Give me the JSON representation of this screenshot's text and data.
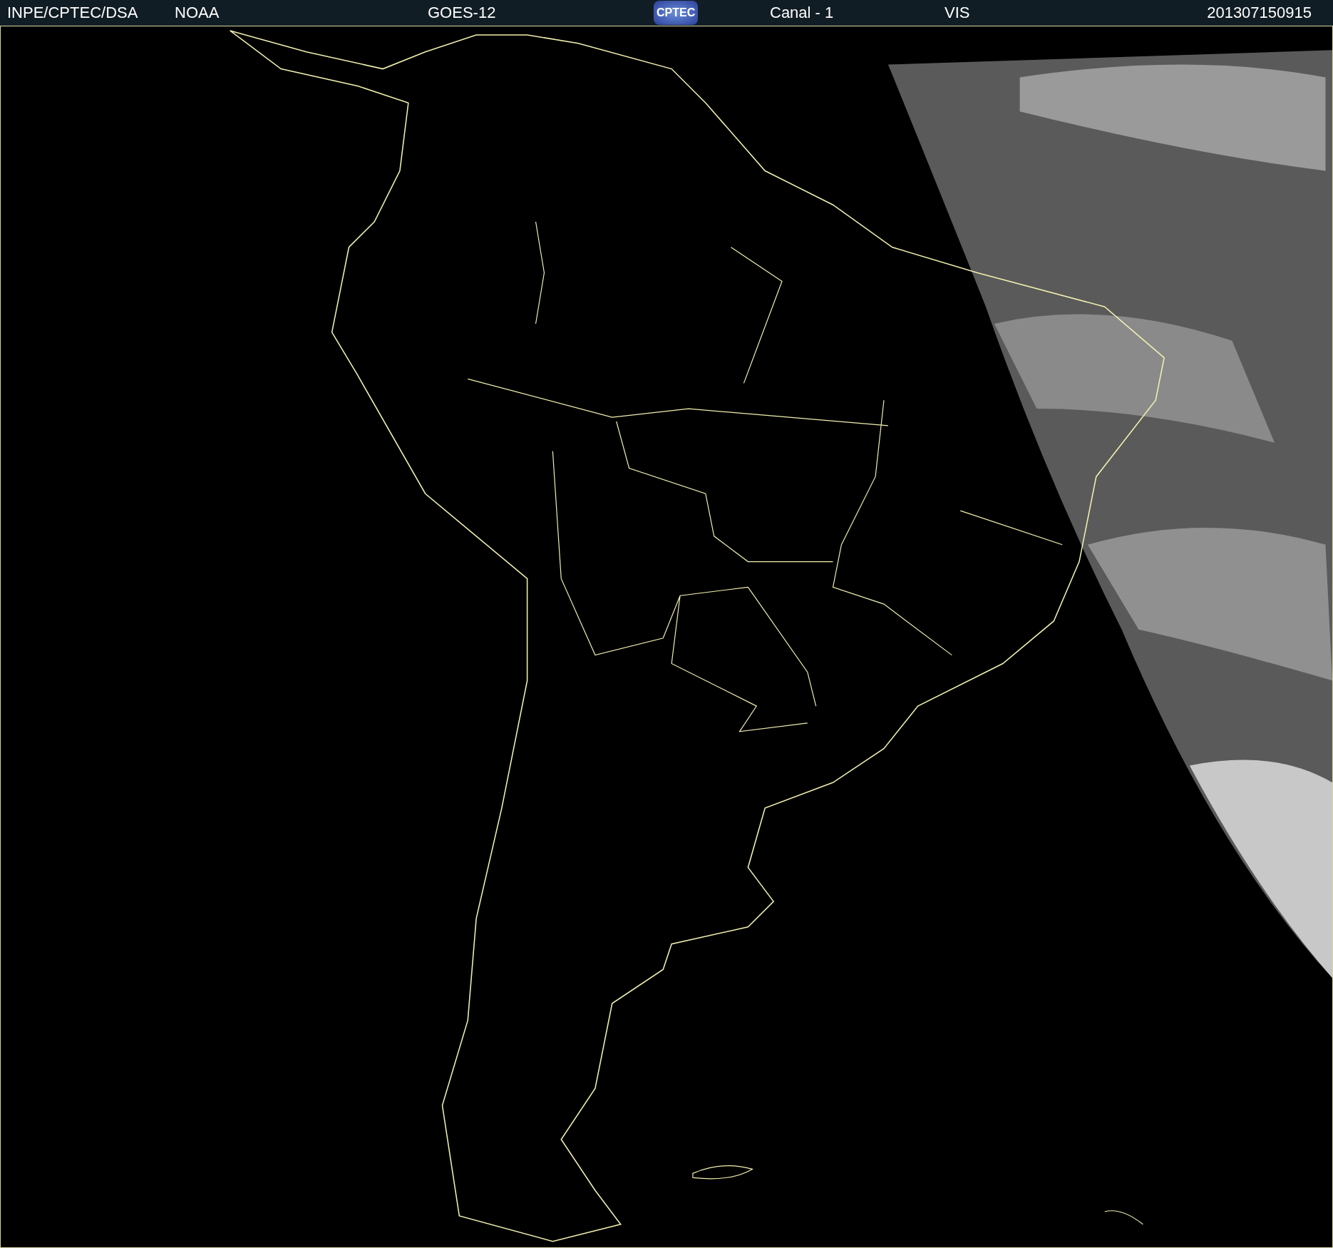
{
  "header": {
    "items": [
      {
        "kind": "text",
        "text": "INPE/CPTEC/DSA"
      },
      {
        "kind": "text",
        "text": "NOAA"
      },
      {
        "kind": "text",
        "text": "GOES-12"
      },
      {
        "kind": "logo",
        "text": "CPTEC"
      },
      {
        "kind": "text",
        "text": "Canal - 1"
      },
      {
        "kind": "text",
        "text": "VIS"
      },
      {
        "kind": "text",
        "text": "201307150915"
      }
    ]
  }
}
